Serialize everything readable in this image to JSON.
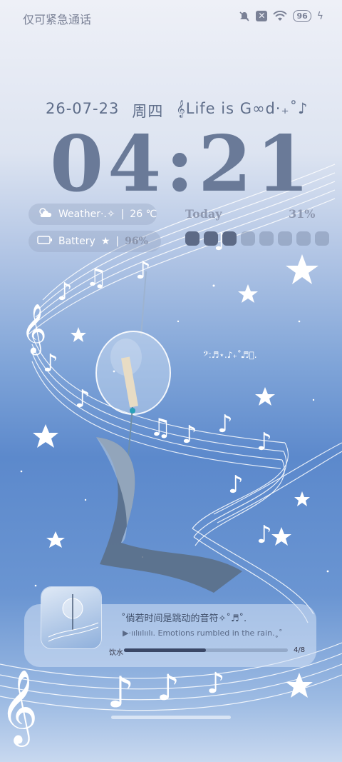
{
  "status_bar": {
    "carrier": "仅可紧急通话",
    "battery": "96",
    "icons": [
      "mute-icon",
      "no-sim-icon",
      "wifi-icon",
      "battery-icon",
      "charging-icon"
    ]
  },
  "lockscreen": {
    "date": "26-07-23",
    "weekday": "周四",
    "motto": "𝄞Life is G∞d·₊˚♪",
    "time": "04:21"
  },
  "widgets": {
    "weather_label": "Weather·.✧",
    "weather_value": "26 ℃",
    "battery_label": "Battery",
    "battery_value": "96%",
    "today_label": "Today",
    "today_percent": "31%",
    "blocks_filled": 3,
    "blocks_total": 8,
    "floating_notes": "𝄢:♬⋆.♪₊˚♬ﾟ."
  },
  "music": {
    "title": "˚倘若时间是跳动的音符✧˚♬˚.",
    "lyric": "▶·ıılıılıılı.  Emotions rumbled in the rain.˳˚",
    "artist": "饮水",
    "progress": 0.5,
    "track_count": "4/8"
  },
  "colors": {
    "accent": "#6a7a98",
    "bg_blue": "#5c89cc"
  }
}
